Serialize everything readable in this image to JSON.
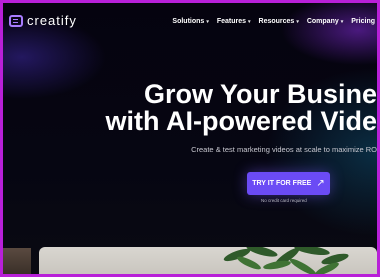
{
  "brand": {
    "name": "creatify"
  },
  "nav": {
    "items": [
      {
        "label": "Solutions",
        "has_dropdown": true
      },
      {
        "label": "Features",
        "has_dropdown": true
      },
      {
        "label": "Resources",
        "has_dropdown": true
      },
      {
        "label": "Company",
        "has_dropdown": true
      },
      {
        "label": "Pricing",
        "has_dropdown": false
      }
    ]
  },
  "hero": {
    "title_line1": "Grow Your Busine",
    "title_line2": "with AI-powered Vide",
    "subtitle": "Create & test marketing videos at scale to maximize RO",
    "cta_label": "TRY IT FOR FREE",
    "cta_icon": "arrow-up-right-icon",
    "cta_color": "#6b4bf5",
    "note": "No credit card required"
  },
  "colors": {
    "frame_border": "#b820d8",
    "accent": "#6b4bf5",
    "logo": "#a87cff"
  }
}
